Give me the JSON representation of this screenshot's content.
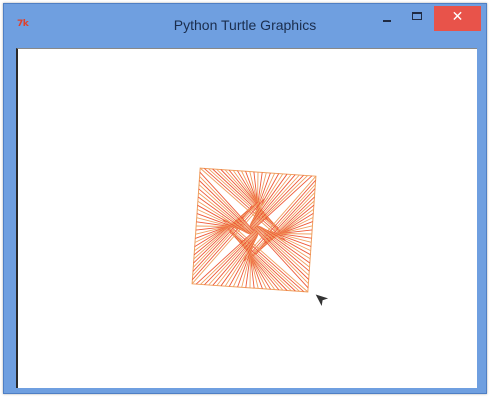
{
  "window": {
    "title": "Python Turtle Graphics",
    "icon_label": "7k",
    "close_glyph": "✕",
    "accent_color": "#6f9fe0",
    "close_color": "#e8534a"
  },
  "drawing": {
    "stroke_color": "#ee5a3a",
    "secondary_color": "#f0a060",
    "cursor_icon": "turtle-arrow-icon"
  }
}
